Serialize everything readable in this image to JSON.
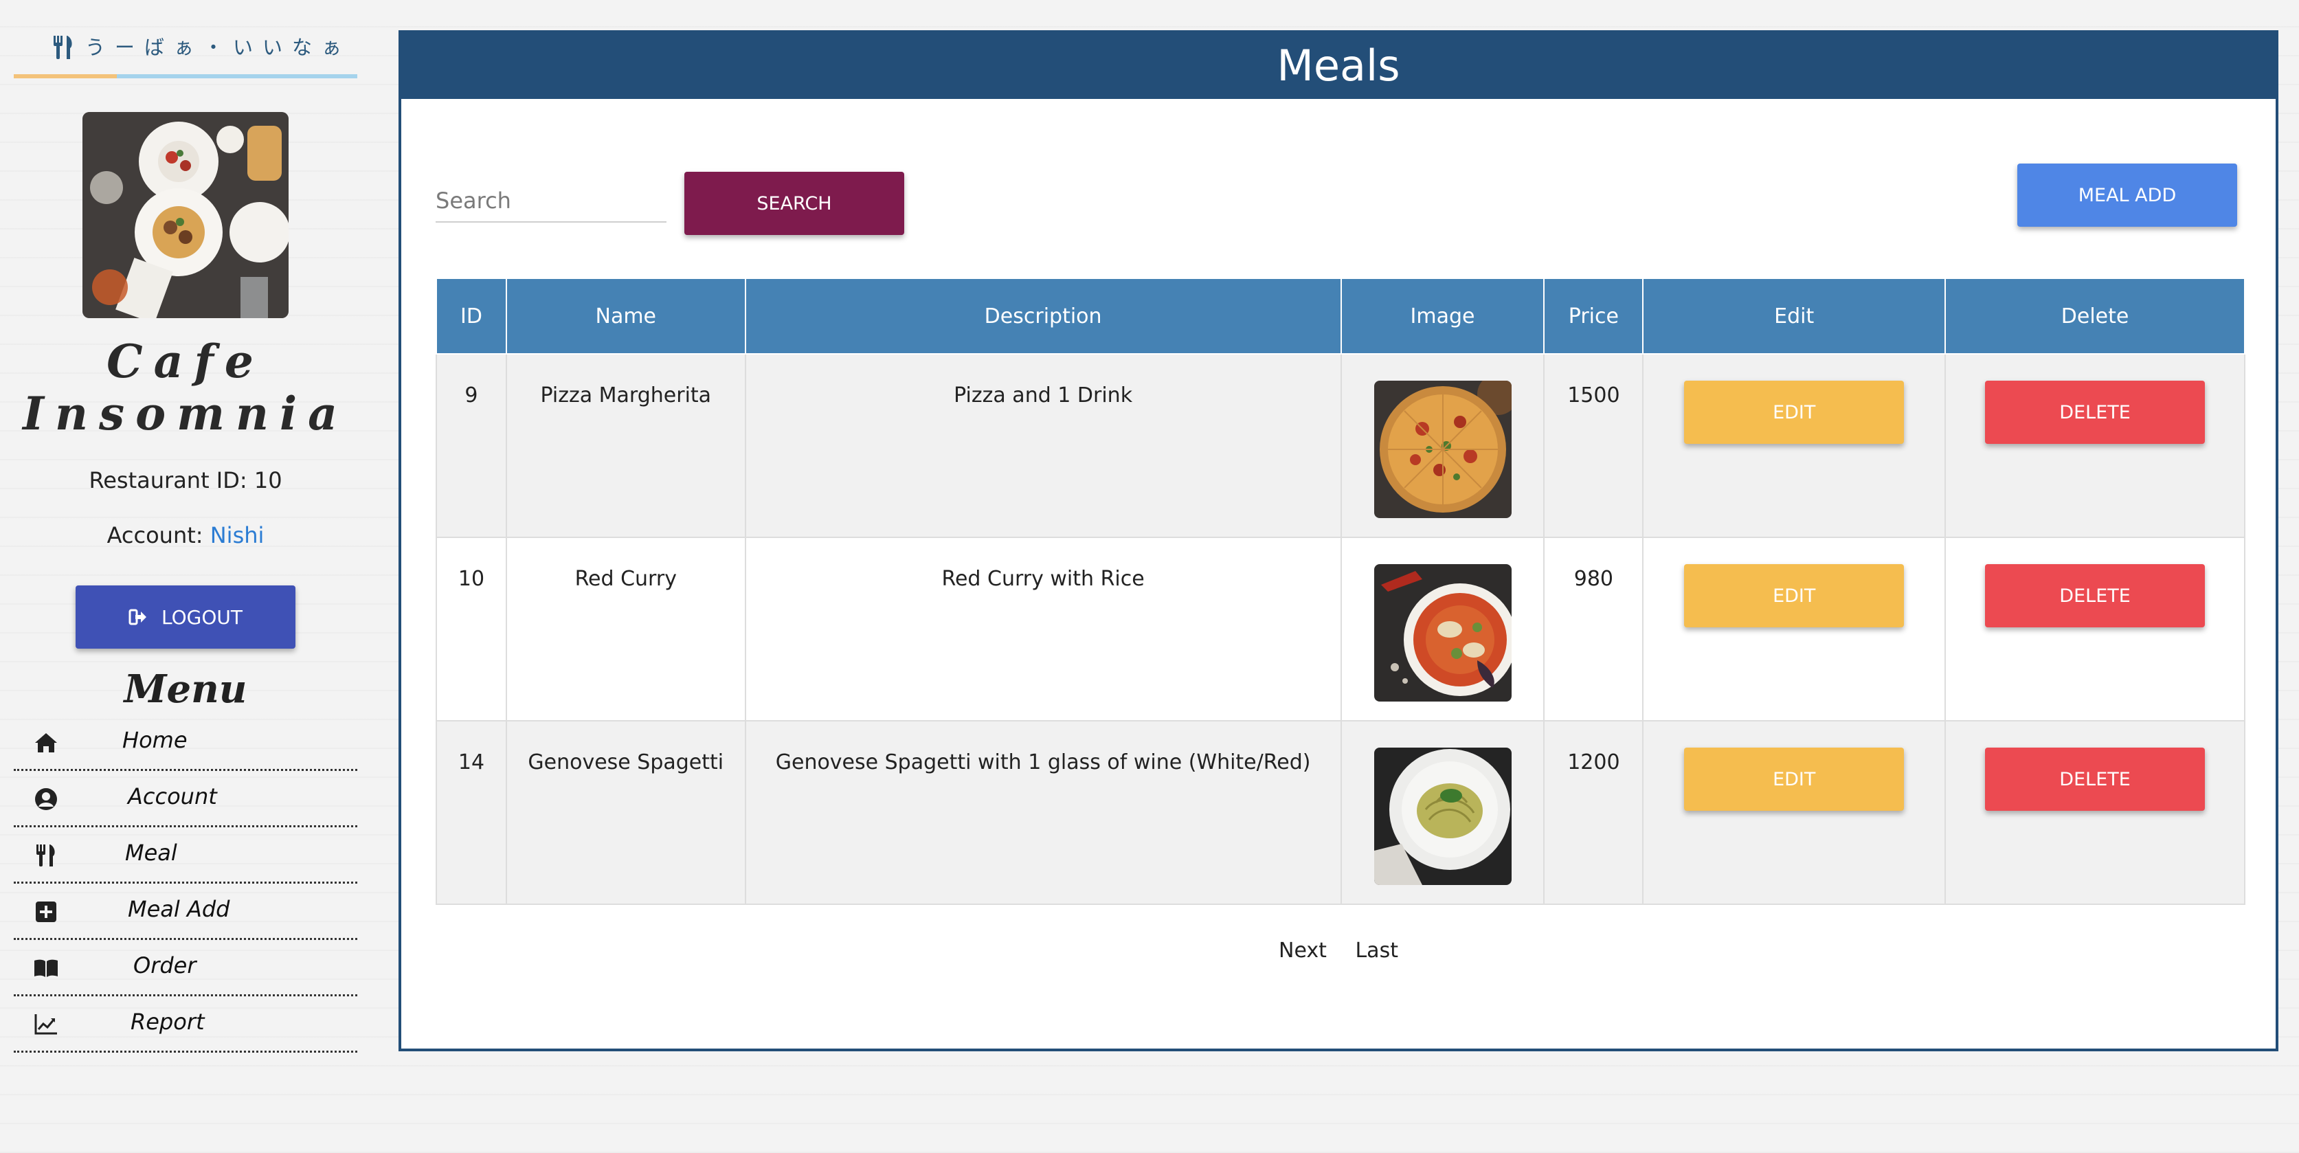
{
  "brand": {
    "text": "うーばぁ・いいなぁ",
    "line_colors": [
      "#f3c27a",
      "#a5d3ec"
    ]
  },
  "sidebar": {
    "cafe_name": "Cafe Insomnia",
    "restaurant_id_label": "Restaurant ID: 10",
    "account_label": "Account: ",
    "account_name": "Nishi",
    "logout_label": "LOGOUT",
    "menu_title": "Menu",
    "menu": [
      {
        "label": "Home",
        "icon": "home-icon"
      },
      {
        "label": "Account",
        "icon": "user-circle-icon"
      },
      {
        "label": "Meal",
        "icon": "fork-knife-icon"
      },
      {
        "label": "Meal Add",
        "icon": "plus-square-icon"
      },
      {
        "label": "Order",
        "icon": "book-icon"
      },
      {
        "label": "Report",
        "icon": "line-chart-icon"
      }
    ]
  },
  "main": {
    "title": "Meals",
    "search_placeholder": "Search",
    "search_label": "SEARCH",
    "meal_add_label": "MEAL ADD",
    "table": {
      "headers": [
        "ID",
        "Name",
        "Description",
        "Image",
        "Price",
        "Edit",
        "Delete"
      ],
      "rows": [
        {
          "id": "9",
          "name": "Pizza Margherita",
          "description": "Pizza and 1 Drink",
          "image": "pizza",
          "price": "1500",
          "edit": "EDIT",
          "delete": "DELETE"
        },
        {
          "id": "10",
          "name": "Red Curry",
          "description": "Red Curry with Rice",
          "image": "red-curry",
          "price": "980",
          "edit": "EDIT",
          "delete": "DELETE"
        },
        {
          "id": "14",
          "name": "Genovese Spagetti",
          "description": "Genovese Spagetti with 1 glass of wine (White/Red)",
          "image": "pasta",
          "price": "1200",
          "edit": "EDIT",
          "delete": "DELETE"
        }
      ]
    },
    "pager": {
      "next": "Next",
      "last": "Last"
    }
  },
  "colors": {
    "header": "#234e78",
    "table_header": "#4582b4",
    "search_button": "#7e1b4d",
    "meal_add_button": "#4f86e6",
    "edit_button": "#f5bd4f",
    "delete_button": "#ec4a51",
    "logout_button": "#3f51b5",
    "account_link": "#2b7cd3"
  }
}
